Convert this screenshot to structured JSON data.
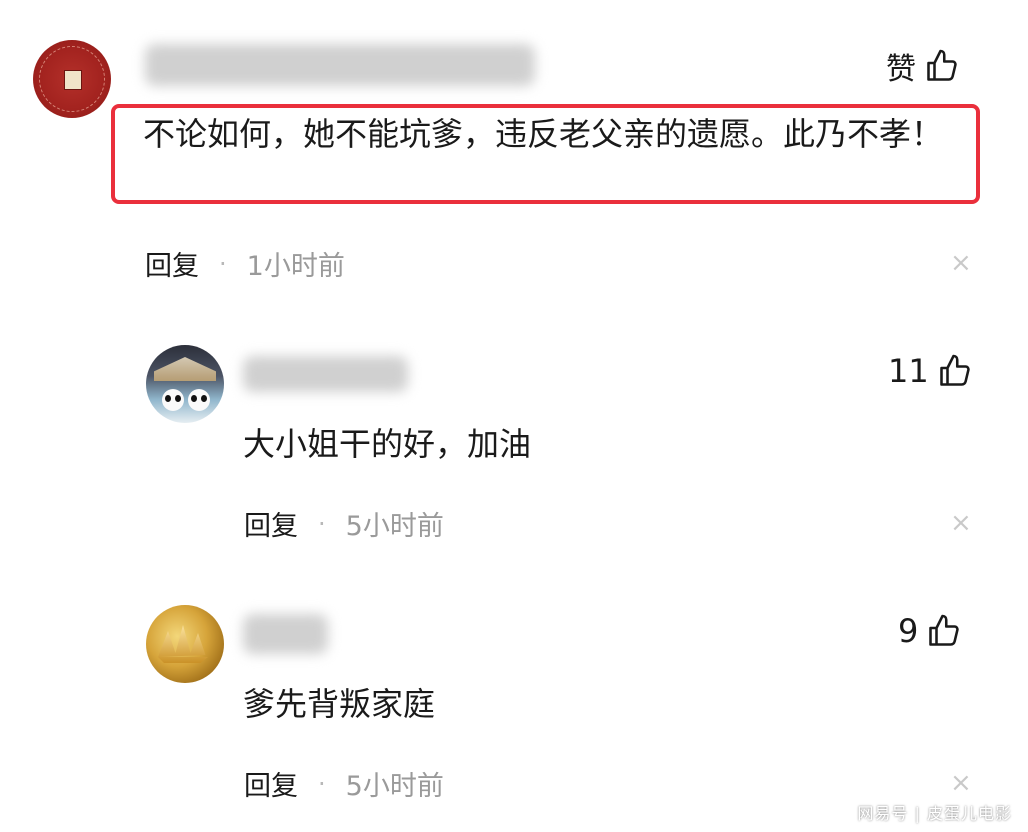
{
  "comments": [
    {
      "text": "不论如何，她不能坑爹，违反老父亲的遗愿。此乃不孝！",
      "like_label": "赞",
      "reply": "回复",
      "dot": "·",
      "time": "1小时前",
      "highlighted": true
    },
    {
      "text": "大小姐干的好，加油",
      "like_count": "11",
      "reply": "回复",
      "dot": "·",
      "time": "5小时前"
    },
    {
      "text": "爹先背叛家庭",
      "like_count": "9",
      "reply": "回复",
      "dot": "·",
      "time": "5小时前"
    }
  ],
  "close_glyph": "×",
  "watermark": "网易号 | 皮蛋儿电影",
  "colors": {
    "highlight_border": "#ea2f3c",
    "time_text": "#9a9a9a"
  },
  "icons": {
    "like": "thumbs-up-icon",
    "close": "close-icon"
  }
}
